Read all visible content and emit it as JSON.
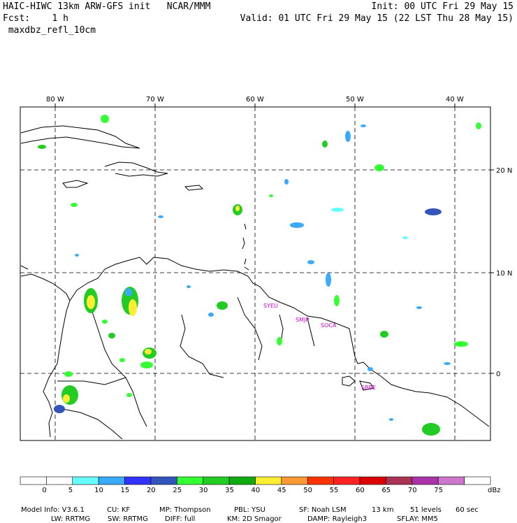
{
  "header": {
    "left_line1": "HAIC-HIWC 13km ARW-GFS init   NCAR/MMM",
    "left_line2": "Fcst:    1 h",
    "left_line3": " maxdbz_refl_10cm",
    "right_line1": "Init: 00 UTC Fri 29 May 15",
    "right_line2": "Valid: 01 UTC Fri 29 May 15 (22 LST Thu 28 May 15)"
  },
  "map": {
    "lon_labels": [
      "80 W",
      "70 W",
      "60 W",
      "50 W",
      "40 W"
    ],
    "lat_labels": [
      "20 N",
      "10 N",
      "0"
    ],
    "stations": [
      "SYEU",
      "SMJP",
      "SOCA",
      "SBBE"
    ],
    "line_color": "#000000"
  },
  "colorbar": {
    "ticks": [
      "0",
      "5",
      "10",
      "15",
      "20",
      "25",
      "30",
      "35",
      "40",
      "45",
      "50",
      "55",
      "60",
      "65",
      "70",
      "75"
    ],
    "unit": "dBz",
    "colors": [
      "#ffffff",
      "#ffffff",
      "#66ffff",
      "#3aaaff",
      "#3333ff",
      "#3355bb",
      "#33ff33",
      "#22cc22",
      "#11aa11",
      "#ffee33",
      "#ff9933",
      "#ff3300",
      "#ff2222",
      "#dd0000",
      "#aa3355",
      "#aa33aa",
      "#cc77cc",
      "#ffffff"
    ]
  },
  "model_info": {
    "line1": [
      "Model Info: V3.6.1",
      "CU: KF",
      "MP: Thompson",
      "PBL: YSU",
      "SF: Noah LSM",
      "13 km",
      "51 levels",
      "60 sec"
    ],
    "line2": [
      "LW: RRTMG",
      "SW: RRTMG",
      "DIFF: full",
      "KM: 2D Smagor",
      "DAMP: Rayleigh3",
      "SFLAY: MM5"
    ]
  }
}
